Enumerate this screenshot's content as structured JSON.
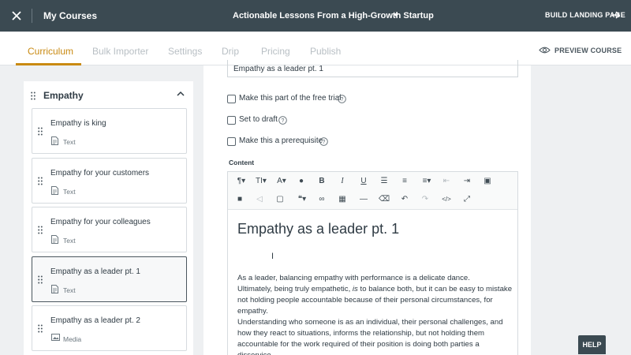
{
  "topbar": {
    "my_courses": "My Courses",
    "course_title": "Actionable Lessons From a High-Growth Startup",
    "build_landing": "BUILD LANDING PAGE"
  },
  "tabs": [
    {
      "label": "Curriculum",
      "active": true
    },
    {
      "label": "Bulk Importer",
      "active": false
    },
    {
      "label": "Settings",
      "active": false
    },
    {
      "label": "Drip",
      "active": false
    },
    {
      "label": "Pricing",
      "active": false
    },
    {
      "label": "Publish",
      "active": false
    }
  ],
  "preview_label": "PREVIEW COURSE",
  "section": {
    "title": "Empathy"
  },
  "lessons": [
    {
      "title": "Empathy is king",
      "type": "Text"
    },
    {
      "title": "Empathy for your customers",
      "type": "Text"
    },
    {
      "title": "Empathy for your colleagues",
      "type": "Text"
    },
    {
      "title": "Empathy as a leader pt. 1",
      "type": "Text",
      "selected": true
    },
    {
      "title": "Empathy as a leader pt. 2",
      "type": "Media"
    }
  ],
  "editor": {
    "lesson_title_value": "Empathy as a leader pt. 1",
    "checkboxes": [
      {
        "label": "Make this part of the free trial",
        "checked": false
      },
      {
        "label": "Set to draft",
        "checked": false
      },
      {
        "label": "Make this a prerequisite",
        "checked": false
      }
    ],
    "content_label": "Content",
    "heading": "Empathy as a leader pt. 1",
    "cursor": "I",
    "body_lines": [
      "As a leader, balancing empathy with performance is a delicate dance.",
      "Ultimately, being truly empathetic, ",
      "is",
      " to balance both, but it can be easy to mistake not holding people accountable because of their personal circumstances, for empathy.",
      "Understanding who someone is as an individual, their personal challenges, and how they react to situations, informs the relationship, but not holding them accountable for the work required of their position is doing both parties a disservice."
    ]
  },
  "help_label": "HELP",
  "colors": {
    "topbar": "#3b4a52",
    "accent": "#c98a12",
    "background": "#eef0f2"
  }
}
